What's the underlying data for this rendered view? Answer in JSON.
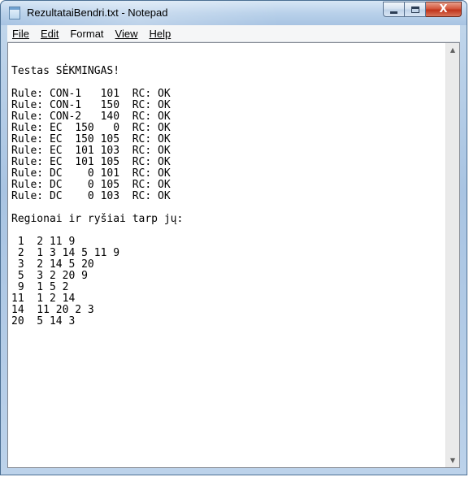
{
  "window": {
    "title": "RezultataiBendri.txt - Notepad",
    "accent_color": "#b9d1ea",
    "close_color": "#c7432a"
  },
  "caption_buttons": {
    "close_label": "X"
  },
  "menu": {
    "items": [
      {
        "label": "File"
      },
      {
        "label": "Edit"
      },
      {
        "label": "Format"
      },
      {
        "label": "View"
      },
      {
        "label": "Help"
      }
    ]
  },
  "document": {
    "lines": [
      "",
      "",
      "Testas SĖKMINGAS!",
      "",
      "Rule: CON-1   101  RC: OK",
      "Rule: CON-1   150  RC: OK",
      "Rule: CON-2   140  RC: OK",
      "Rule: EC  150   0  RC: OK",
      "Rule: EC  150 105  RC: OK",
      "Rule: EC  101 103  RC: OK",
      "Rule: EC  101 105  RC: OK",
      "Rule: DC    0 101  RC: OK",
      "Rule: DC    0 105  RC: OK",
      "Rule: DC    0 103  RC: OK",
      "",
      "Regionai ir ryšiai tarp jų:",
      "",
      " 1  2 11 9",
      " 2  1 3 14 5 11 9",
      " 3  2 14 5 20",
      " 5  3 2 20 9",
      " 9  1 5 2",
      "11  1 2 14",
      "14  11 20 2 3",
      "20  5 14 3"
    ]
  },
  "scrollbar": {
    "up_icon": "scroll-up-arrow-icon",
    "down_icon": "scroll-down-arrow-icon"
  }
}
